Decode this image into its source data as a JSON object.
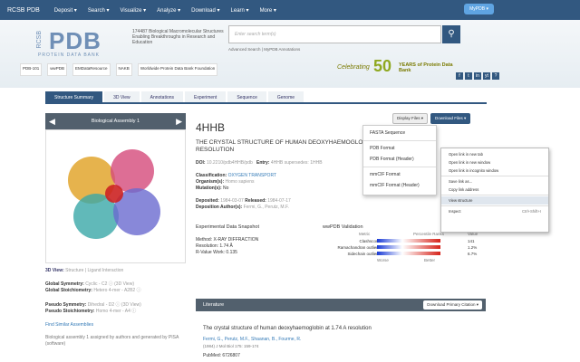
{
  "nav": {
    "brand": "RCSB PDB",
    "items": [
      "Deposit ▾",
      "Search ▾",
      "Visualize ▾",
      "Analyze ▾",
      "Download ▾",
      "Learn ▾",
      "More ▾"
    ],
    "mypdb": "MyPDB ▾"
  },
  "logo": {
    "big": "PDB",
    "rc": "RCSB",
    "sub": "PROTEIN DATA BANK"
  },
  "tagline": "174487 Biological Macromolecular Structures Enabling Breakthroughs in Research and Education",
  "search": {
    "placeholder": "Enter search term(s)",
    "icon": "search-icon",
    "links": "Advanced Search | MyPDB Annotations"
  },
  "partners": [
    "PDB-101",
    "wwPDB",
    "EMDataResource",
    "NAKB",
    "Worldwide Protein Data Bank Foundation"
  ],
  "anniv": {
    "celebrating": "Celebrating",
    "n": "50",
    "years": "YEARS of Protein Data Bank"
  },
  "social": [
    "f",
    "t",
    "in",
    "yt",
    "?"
  ],
  "tabs": [
    "Structure Summary",
    "3D View",
    "Annotations",
    "Experiment",
    "Sequence",
    "Genome"
  ],
  "assembly": {
    "title": "Biological Assembly 1",
    "view3d": "3D View:",
    "view3d_links": "Structure | Ligand Interaction",
    "global_sym_label": "Global Symmetry:",
    "global_sym": "Cyclic - C2 ⓘ (3D View)",
    "global_stoich_label": "Global Stoichiometry:",
    "global_stoich": "Hetero 4-mer - A2B2 ⓘ",
    "pseudo_sym_label": "Pseudo Symmetry:",
    "pseudo_sym": "Dihedral - D2 ⓘ (3D View)",
    "pseudo_stoich_label": "Pseudo Stoichiometry:",
    "pseudo_stoich": "Homo 4-mer - A4 ⓘ",
    "find": "Find Similar Assemblies",
    "bio": "Biological assembly 1 assigned by authors and generated by PISA (software)"
  },
  "entry": {
    "id": "4HHB",
    "title": "THE CRYSTAL STRUCTURE OF HUMAN DEOXYHAEMOGLOBIN AT 1.74 ANGSTROMS RESOLUTION",
    "doi_label": "DOI:",
    "doi": "10.2210/pdb4HHB/pdb",
    "entry_label": "Entry:",
    "entry": "4HHB supersedes: 1HHB",
    "class_label": "Classification:",
    "class": "OXYGEN TRANSPORT",
    "org_label": "Organism(s):",
    "org": "Homo sapiens",
    "mut_label": "Mutation(s):",
    "mut": "No",
    "dep_label": "Deposited:",
    "dep": "1984-03-07",
    "rel_label": "Released:",
    "rel": "1984-07-17",
    "auth_label": "Deposition Author(s):",
    "auth": "Fermi, G., Perutz, M.F."
  },
  "snapshot": {
    "title": "Experimental Data Snapshot",
    "method": "Method: X-RAY DIFFRACTION",
    "res": "Resolution: 1.74 Å",
    "rfree": "R-Value Work: 0.135"
  },
  "validation": {
    "title": "wwPDB Validation",
    "metric": "Metric",
    "ranks": "Percentile Ranks",
    "value": "Value",
    "rows": [
      {
        "m": "Clashscore",
        "v": "141"
      },
      {
        "m": "Ramachandran outliers",
        "v": "1.2%"
      },
      {
        "m": "Sidechain outliers",
        "v": "6.7%"
      }
    ],
    "worse": "Worse",
    "better": "Better"
  },
  "buttons": {
    "display": "Display Files ▾",
    "download": "Download Files ▾"
  },
  "dropdown": [
    "FASTA Sequence",
    "PDB Format",
    "PDB Format (Header)",
    "mmCIF Format",
    "mmCIF Format (Header)"
  ],
  "ctx": [
    {
      "t": "Open link in new tab",
      "k": ""
    },
    {
      "t": "Open link in new window",
      "k": ""
    },
    {
      "t": "Open link in incognito window",
      "k": ""
    },
    {
      "t": "Save link as...",
      "k": ""
    },
    {
      "t": "Copy link address",
      "k": ""
    },
    {
      "t": "View structure",
      "k": ""
    },
    {
      "t": "Inspect",
      "k": "Ctrl+Shift+I"
    }
  ],
  "lit": {
    "title": "Literature",
    "download": "Download Primary Citation ▾"
  },
  "paper": {
    "title": "The crystal structure of human deoxyhaemoglobin at 1.74 A resolution",
    "authors": "Fermi, G., Perutz, M.F., Shaanan, B., Fourme, R.",
    "journal": "(1984) J Mol Biol 175: 159-174",
    "pubmed": "PubMed: 6726807"
  }
}
